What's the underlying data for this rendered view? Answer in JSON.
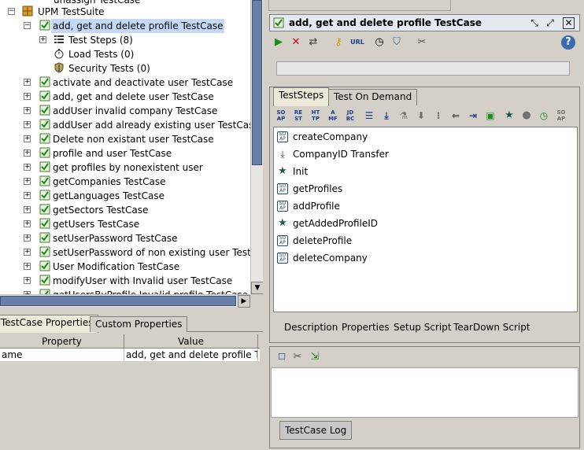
{
  "tree": {
    "top_partial": "unassign TestCase",
    "suite": "UPM TestSuite",
    "selected_case": "add, get and delete profile TestCase",
    "children": [
      {
        "label": "Test Steps (8)"
      },
      {
        "label": "Load Tests (0)"
      },
      {
        "label": "Security Tests (0)"
      }
    ],
    "cases": [
      "activate and deactivate user TestCase",
      "add, get and delete user TestCase",
      "addUser invalid company TestCase",
      "addUser add already existing user TestCase",
      "Delete non existant user TestCase",
      "profile and user TestCase",
      "get profiles by nonexistent user",
      "getCompanies TestCase",
      "getLanguages TestCase",
      "getSectors TestCase",
      "getUsers TestCase",
      "setUserPassword TestCase",
      "setUserPassword of non existing user TestCase",
      "User Modification TestCase",
      "modifyUser with Invalid user TestCase",
      "getUsersByProfile Invalid profile TestCase"
    ]
  },
  "props": {
    "tabs": [
      "TestCase Properties",
      "Custom Properties"
    ],
    "col_property": "Property",
    "col_value": "Value",
    "row_name": "ame",
    "row_value": "add, get and delete profile Te..."
  },
  "testcase": {
    "title": "add, get and delete profile TestCase",
    "url_label": "URL",
    "tabs": [
      "TestSteps",
      "Test On Demand"
    ],
    "toolbar_icons": [
      {
        "l1": "SO",
        "l2": "AP"
      },
      {
        "l1": "RE",
        "l2": "ST"
      },
      {
        "l1": "HT",
        "l2": "TP"
      },
      {
        "l1": "A",
        "l2": "MF"
      },
      {
        "l1": "JD",
        "l2": "BC"
      }
    ],
    "toolbar_icons_right": [
      {
        "l1": "SO",
        "l2": "AP"
      }
    ],
    "steps": [
      {
        "label": "createCompany",
        "icon": "soap"
      },
      {
        "label": "CompanyID Transfer",
        "icon": "transfer"
      },
      {
        "label": "Init",
        "icon": "groovy"
      },
      {
        "label": "getProfiles",
        "icon": "soap"
      },
      {
        "label": "addProfile",
        "icon": "soap"
      },
      {
        "label": "getAddedProfileID",
        "icon": "groovy"
      },
      {
        "label": "deleteProfile",
        "icon": "soap"
      },
      {
        "label": "deleteCompany",
        "icon": "soap"
      }
    ],
    "soap_icon_text": "SO AP",
    "bottom_tabs": [
      "Description",
      "Properties",
      "Setup Script",
      "TearDown Script"
    ],
    "log_tab": "TestCase Log"
  }
}
